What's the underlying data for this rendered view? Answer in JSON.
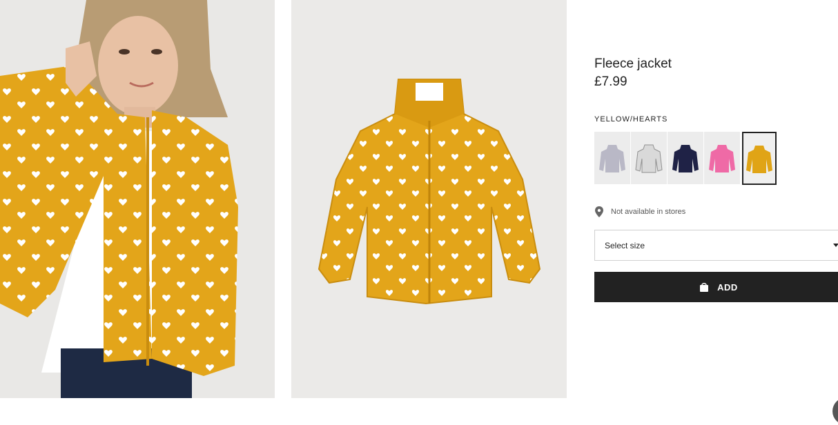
{
  "product": {
    "title": "Fleece jacket",
    "price": "£7.99",
    "color_name": "YELLOW/HEARTS",
    "image_alts": [
      "model-photo",
      "flat-photo"
    ]
  },
  "swatches": [
    {
      "label": "grey",
      "color": "#b9b8c6"
    },
    {
      "label": "white-circles",
      "color": "#d9d9d9"
    },
    {
      "label": "navy-stars",
      "color": "#1f2246"
    },
    {
      "label": "pink",
      "color": "#ef6aa6"
    },
    {
      "label": "yellow-hearts",
      "color": "#e0a416"
    }
  ],
  "availability": {
    "text": "Not available in stores",
    "icon": "location-pin-icon"
  },
  "size_select": {
    "label": "Select size",
    "icon": "chevron-down-icon"
  },
  "add_button": {
    "label": "ADD",
    "icon": "shopping-bag-icon"
  },
  "colors": {
    "jacket": "#e3a51a",
    "heart": "#ffffff",
    "button_bg": "#222222"
  }
}
